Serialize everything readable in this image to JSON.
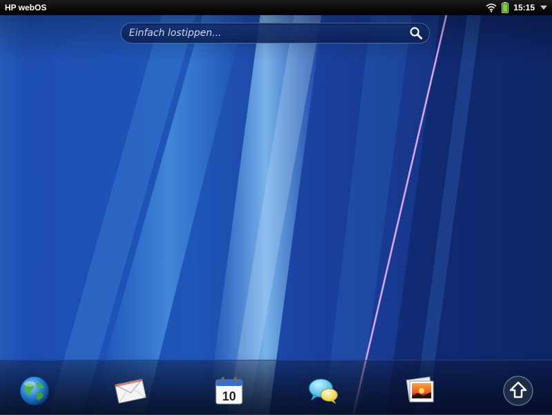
{
  "status_bar": {
    "title": "HP webOS",
    "time": "15:15",
    "icons": [
      "wifi-icon",
      "battery-icon",
      "menu-arrow-icon"
    ]
  },
  "search": {
    "placeholder": "Einfach lostippen...",
    "value": ""
  },
  "calendar_day": "10",
  "dock": {
    "apps": [
      "web-browser",
      "email",
      "calendar",
      "messaging",
      "photos",
      "launcher"
    ]
  },
  "colors": {
    "wallpaper": "#1a3d9a",
    "status_bar": "#000000",
    "battery": "#7cd043"
  }
}
